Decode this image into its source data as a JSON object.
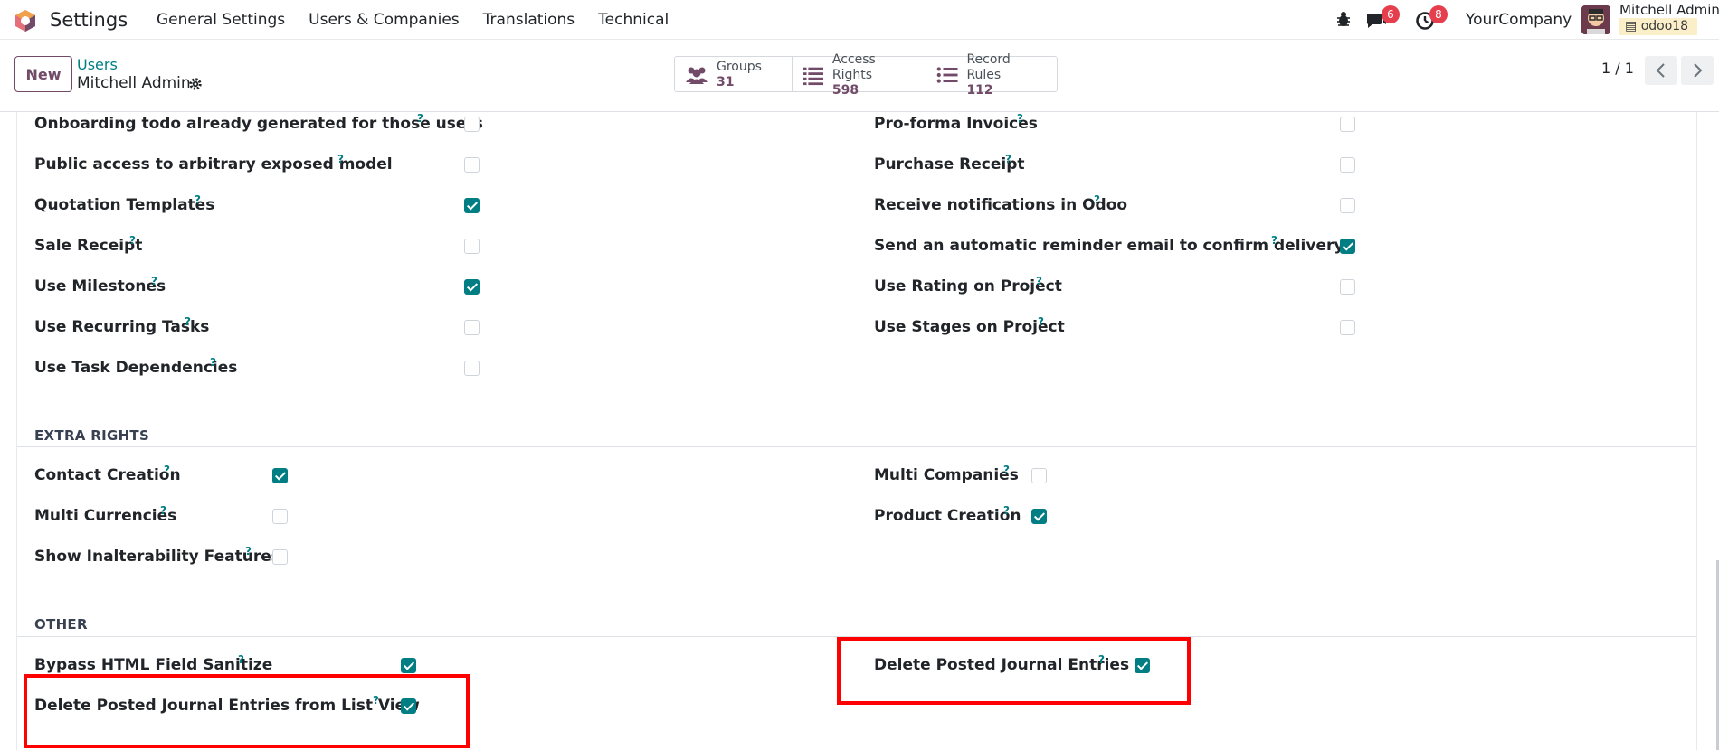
{
  "navbar": {
    "app_name": "Settings",
    "menu": [
      "General Settings",
      "Users & Companies",
      "Translations",
      "Technical"
    ],
    "messages_count": "6",
    "activities_count": "8",
    "company": "YourCompany",
    "user_name": "Mitchell Admin",
    "database": "odoo18"
  },
  "control": {
    "new_label": "New",
    "breadcrumb": "Users",
    "record_name": "Mitchell Admin",
    "smart_buttons": [
      {
        "label": "Groups",
        "value": "31",
        "icon": "users-icon"
      },
      {
        "label": "Access Rights",
        "value": "598",
        "icon": "list-icon"
      },
      {
        "label": "Record Rules",
        "value": "112",
        "icon": "list-icon"
      }
    ],
    "pager": "1 / 1"
  },
  "fields_top": {
    "left": [
      {
        "label": "Onboarding todo already generated for those users",
        "checked": false
      },
      {
        "label": "Public access to arbitrary exposed model",
        "checked": false
      },
      {
        "label": "Quotation Templates",
        "checked": true
      },
      {
        "label": "Sale Receipt",
        "checked": false
      },
      {
        "label": "Use Milestones",
        "checked": true
      },
      {
        "label": "Use Recurring Tasks",
        "checked": false
      },
      {
        "label": "Use Task Dependencies",
        "checked": false
      }
    ],
    "right": [
      {
        "label": "Pro-forma Invoices",
        "checked": false
      },
      {
        "label": "Purchase Receipt",
        "checked": false
      },
      {
        "label": "Receive notifications in Odoo",
        "checked": false
      },
      {
        "label": "Send an automatic reminder email to confirm delivery",
        "checked": true
      },
      {
        "label": "Use Rating on Project",
        "checked": false
      },
      {
        "label": "Use Stages on Project",
        "checked": false
      }
    ]
  },
  "extra_rights": {
    "title": "EXTRA RIGHTS",
    "left": [
      {
        "label": "Contact Creation",
        "checked": true
      },
      {
        "label": "Multi Currencies",
        "checked": false
      },
      {
        "label": "Show Inalterability Features",
        "checked": false
      }
    ],
    "right": [
      {
        "label": "Multi Companies",
        "checked": false
      },
      {
        "label": "Product Creation",
        "checked": true
      }
    ]
  },
  "other": {
    "title": "OTHER",
    "left": [
      {
        "label": "Bypass HTML Field Sanitize",
        "checked": true
      },
      {
        "label": "Delete Posted Journal Entries from List View",
        "checked": true
      }
    ],
    "right": [
      {
        "label": "Delete Posted Journal Entries",
        "checked": true
      }
    ]
  },
  "help_mark": "?",
  "colors": {
    "brand": "#714b67",
    "accent": "#017e84",
    "highlight": "#ff0000",
    "badge": "#e53e4d"
  }
}
